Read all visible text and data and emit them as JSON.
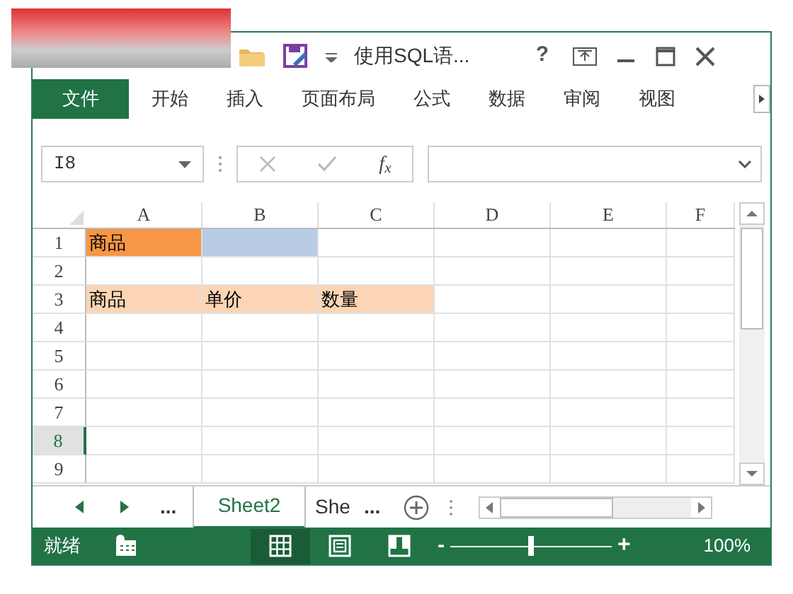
{
  "title_bar": {
    "title": "使用SQL语...",
    "help": "?"
  },
  "ribbon_tabs": [
    {
      "label": "文件",
      "kind": "file"
    },
    {
      "label": "开始",
      "kind": "tab"
    },
    {
      "label": "插入",
      "kind": "tab"
    },
    {
      "label": "页面布局",
      "kind": "tab"
    },
    {
      "label": "公式",
      "kind": "tab"
    },
    {
      "label": "数据",
      "kind": "tab"
    },
    {
      "label": "审阅",
      "kind": "tab"
    },
    {
      "label": "视图",
      "kind": "tab"
    }
  ],
  "formula_bar": {
    "name_box": "I8",
    "fx": "f$_{x}$"
  },
  "columns": [
    "A",
    "B",
    "C",
    "D",
    "E",
    "F"
  ],
  "rows": [
    {
      "header": "1",
      "selected": false,
      "cells": [
        {
          "text": "商品",
          "color": "#f79646"
        },
        {
          "color": "#b8cce4"
        },
        {},
        {},
        {},
        {}
      ]
    },
    {
      "header": "2",
      "selected": false,
      "cells": [
        {},
        {},
        {},
        {},
        {},
        {}
      ]
    },
    {
      "header": "3",
      "selected": false,
      "cells": [
        {
          "text": "商品",
          "color": "#fcd5b4"
        },
        {
          "text": "单价",
          "color": "#fcd5b4"
        },
        {
          "text": "数量",
          "color": "#fcd5b4"
        },
        {},
        {},
        {}
      ]
    },
    {
      "header": "4",
      "selected": false,
      "cells": [
        {},
        {},
        {},
        {},
        {},
        {}
      ]
    },
    {
      "header": "5",
      "selected": false,
      "cells": [
        {},
        {},
        {},
        {},
        {},
        {}
      ]
    },
    {
      "header": "6",
      "selected": false,
      "cells": [
        {},
        {},
        {},
        {},
        {},
        {}
      ]
    },
    {
      "header": "7",
      "selected": false,
      "cells": [
        {},
        {},
        {},
        {},
        {},
        {}
      ]
    },
    {
      "header": "8",
      "selected": true,
      "cells": [
        {},
        {},
        {},
        {},
        {},
        {}
      ]
    },
    {
      "header": "9",
      "selected": false,
      "cells": [
        {},
        {},
        {},
        {},
        {},
        {}
      ]
    }
  ],
  "sheet_nav": {
    "more_left": "...",
    "more_right": "..."
  },
  "sheet_tabs": [
    {
      "label": "Sheet2",
      "selected": true
    },
    {
      "label": "She",
      "selected": false
    }
  ],
  "status_bar": {
    "status": "就绪",
    "zoom_minus": "-",
    "zoom_plus": "+",
    "level": 0.5,
    "zoom": "100%",
    "views": [
      {
        "kind": "normal",
        "selected": true
      },
      {
        "kind": "page_layout",
        "selected": false
      },
      {
        "kind": "page_break",
        "selected": false
      }
    ]
  }
}
